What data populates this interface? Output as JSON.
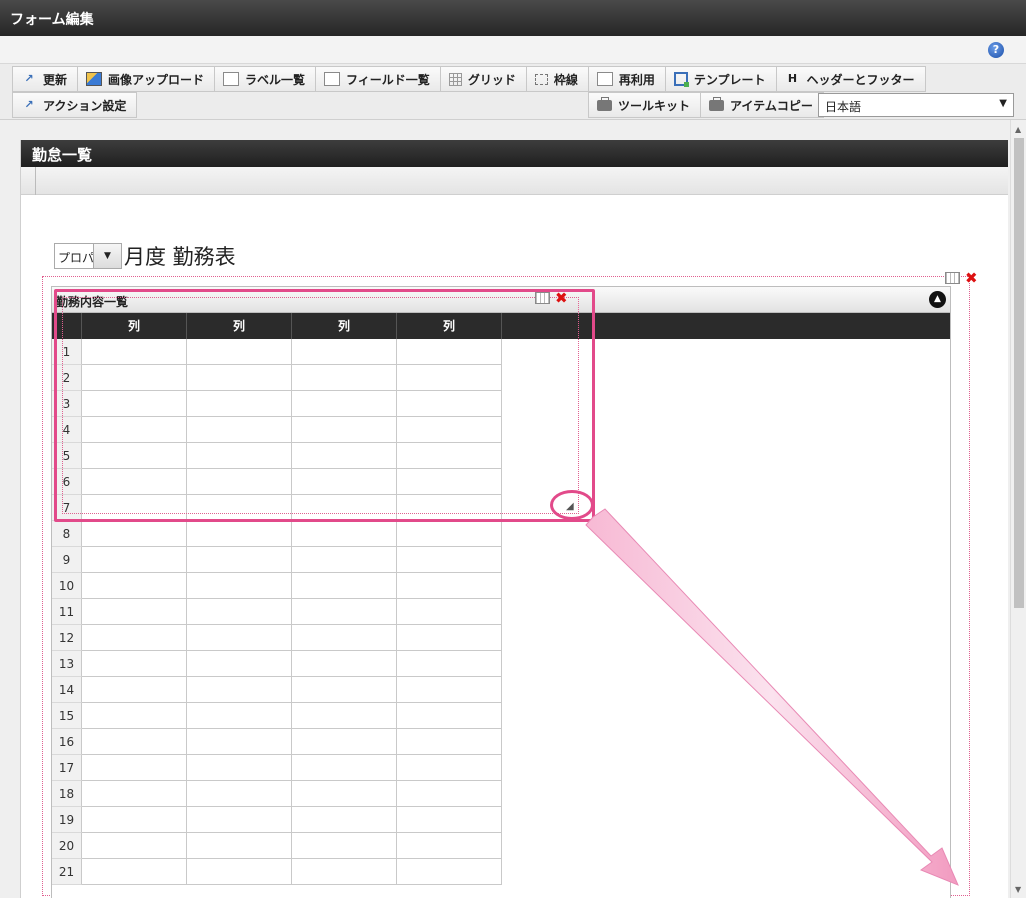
{
  "window": {
    "title": "フォーム編集"
  },
  "help": {
    "icon": "?"
  },
  "toolbar": {
    "row1": [
      {
        "label": "更新",
        "icon": "update-icon"
      },
      {
        "label": "画像アップロード",
        "icon": "image-upload-icon"
      },
      {
        "label": "ラベル一覧",
        "icon": "label-list-icon"
      },
      {
        "label": "フィールド一覧",
        "icon": "field-list-icon"
      },
      {
        "label": "グリッド",
        "icon": "grid-icon"
      },
      {
        "label": "枠線",
        "icon": "border-icon"
      },
      {
        "label": "再利用",
        "icon": "reuse-icon"
      },
      {
        "label": "テンプレート",
        "icon": "template-icon"
      },
      {
        "label": "ヘッダーとフッター",
        "icon": "header-footer-icon",
        "glyph": "H"
      }
    ],
    "row2": [
      {
        "label": "アクション設定",
        "icon": "action-settings-icon"
      }
    ],
    "right": [
      {
        "label": "ツールキット",
        "icon": "toolkit-icon"
      },
      {
        "label": "アイテムコピー",
        "icon": "item-copy-icon"
      }
    ],
    "language": {
      "value": "日本語"
    }
  },
  "page": {
    "header": "勤怠一覧"
  },
  "form": {
    "month_select_value": "プロパ",
    "title": "月度 勤務表"
  },
  "table": {
    "caption": "勤務内容一覧",
    "columns": [
      "列",
      "列",
      "列",
      "列"
    ],
    "rows": [
      "1",
      "2",
      "3",
      "4",
      "5",
      "6",
      "7",
      "8",
      "9",
      "10",
      "11",
      "12",
      "13",
      "14",
      "15",
      "16",
      "17",
      "18",
      "19",
      "20",
      "21"
    ]
  },
  "colors": {
    "highlight": "#e24a8a",
    "arrow": "#f4a6c8"
  }
}
